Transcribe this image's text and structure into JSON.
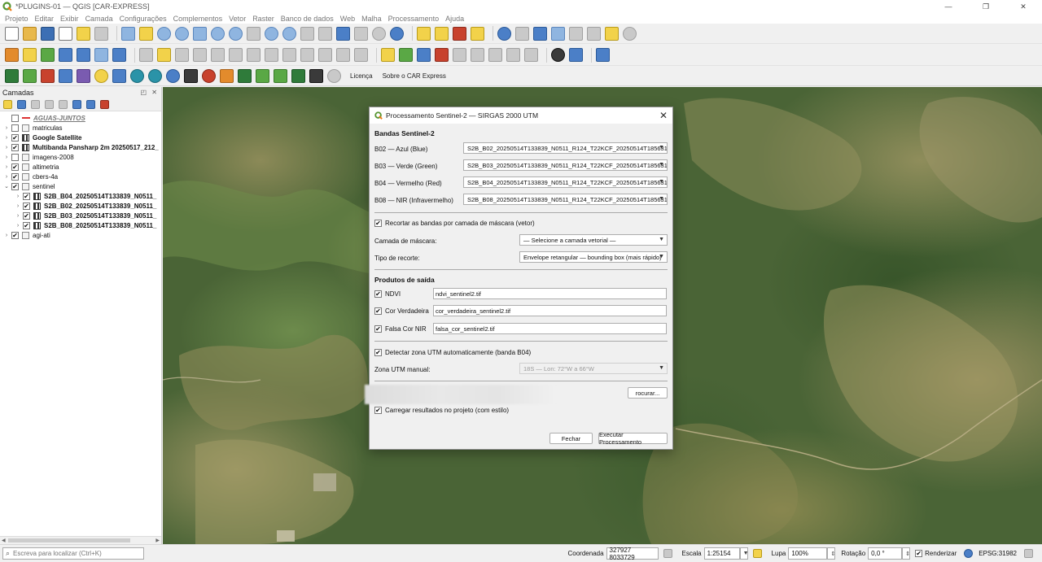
{
  "window": {
    "title": "*PLUGINS-01 — QGIS [CAR-EXPRESS]",
    "minimize": "—",
    "maximize": "❐",
    "close": "✕"
  },
  "menu": [
    "Projeto",
    "Editar",
    "Exibir",
    "Camada",
    "Configurações",
    "Complementos",
    "Vetor",
    "Raster",
    "Banco de dados",
    "Web",
    "Malha",
    "Processamento",
    "Ajuda"
  ],
  "toolbar3_links": {
    "licenca": "Licença",
    "sobre": "Sobre o CAR Express"
  },
  "layers_panel": {
    "title": "Camadas",
    "controls": "◰ ✕",
    "layers": [
      {
        "name": "AGUAS-JUNTOS",
        "checked": false,
        "expandable": false,
        "style": "italic",
        "indent": 0
      },
      {
        "name": "matriculas",
        "checked": false,
        "expandable": true,
        "style": "normal",
        "indent": 0
      },
      {
        "name": "Google Satellite",
        "checked": true,
        "expandable": true,
        "style": "bold",
        "indent": 0
      },
      {
        "name": "Multibanda Pansharp 2m  20250517_212_",
        "checked": true,
        "expandable": true,
        "style": "bold",
        "indent": 0
      },
      {
        "name": "imagens-2008",
        "checked": false,
        "expandable": true,
        "style": "normal",
        "indent": 0
      },
      {
        "name": "altimetria",
        "checked": true,
        "expandable": true,
        "style": "normal",
        "indent": 0
      },
      {
        "name": "cbers-4a",
        "checked": true,
        "expandable": true,
        "style": "normal",
        "indent": 0
      },
      {
        "name": "sentinel",
        "checked": true,
        "expandable": true,
        "expanded": true,
        "style": "normal",
        "indent": 0
      },
      {
        "name": "S2B_B04_20250514T133839_N0511_",
        "checked": true,
        "expandable": true,
        "style": "bold",
        "indent": 1
      },
      {
        "name": "S2B_B02_20250514T133839_N0511_",
        "checked": true,
        "expandable": true,
        "style": "bold",
        "indent": 1
      },
      {
        "name": "S2B_B03_20250514T133839_N0511_",
        "checked": true,
        "expandable": true,
        "style": "bold",
        "indent": 1
      },
      {
        "name": "S2B_B08_20250514T133839_N0511_",
        "checked": true,
        "expandable": true,
        "style": "bold",
        "indent": 1
      },
      {
        "name": "agi-ati",
        "checked": true,
        "expandable": true,
        "style": "normal",
        "indent": 0
      }
    ]
  },
  "dialog": {
    "title": "Processamento Sentinel-2 — SIRGAS 2000 UTM",
    "bands_section": "Bandas Sentinel-2",
    "bands": [
      {
        "label": "B02 — Azul (Blue)",
        "value": "S2B_B02_20250514T133839_N0511_R124_T22KCF_20250514T185631"
      },
      {
        "label": "B03 — Verde (Green)",
        "value": "S2B_B03_20250514T133839_N0511_R124_T22KCF_20250514T185631"
      },
      {
        "label": "B04 — Vermelho (Red)",
        "value": "S2B_B04_20250514T133839_N0511_R124_T22KCF_20250514T185631"
      },
      {
        "label": "B08 — NIR (Infravermelho)",
        "value": "S2B_B08_20250514T133839_N0511_R124_T22KCF_20250514T185631"
      }
    ],
    "clip_check_label": "Recortar as bandas por camada de máscara (vetor)",
    "clip_checked": true,
    "mask_label": "Camada de máscara:",
    "mask_value": "— Selecione a camada vetorial —",
    "cut_type_label": "Tipo de recorte:",
    "cut_type_value": "Envelope retangular — bounding box (mais rápido)",
    "outputs_section": "Produtos de saída",
    "outputs": [
      {
        "label": "NDVI",
        "checked": true,
        "file": "ndvi_sentinel2.tif"
      },
      {
        "label": "Cor Verdadeira",
        "checked": true,
        "file": "cor_verdadeira_sentinel2.tif"
      },
      {
        "label": "Falsa Cor NIR",
        "checked": true,
        "file": "falsa_cor_sentinel2.tif"
      }
    ],
    "utm_auto_label": "Detectar zona UTM automaticamente (banda B04)",
    "utm_auto_checked": true,
    "utm_manual_label": "Zona UTM manual:",
    "utm_manual_value": "18S — Lon: 72°W a 66°W",
    "browse_button": "rocurar...",
    "load_results_label": "Carregar resultados no projeto (com estilo)",
    "load_results_checked": true,
    "close_button": "Fechar",
    "run_button": "Executar Processamento"
  },
  "statusbar": {
    "locator_placeholder": "Escreva para localizar (Ctrl+K)",
    "coord_label": "Coordenada",
    "coord_value": "327927  8033729",
    "scale_label": "Escala",
    "scale_value": "1:25154",
    "lupa_label": "Lupa",
    "lupa_value": "100%",
    "rotation_label": "Rotação",
    "rotation_value": "0,0 °",
    "render_label": "Renderizar",
    "render_checked": true,
    "epsg": "EPSG:31982"
  },
  "colors": {
    "qgis_green": "#589632",
    "map_forest": "#3e5c2f",
    "map_pasture": "#9a9462"
  }
}
